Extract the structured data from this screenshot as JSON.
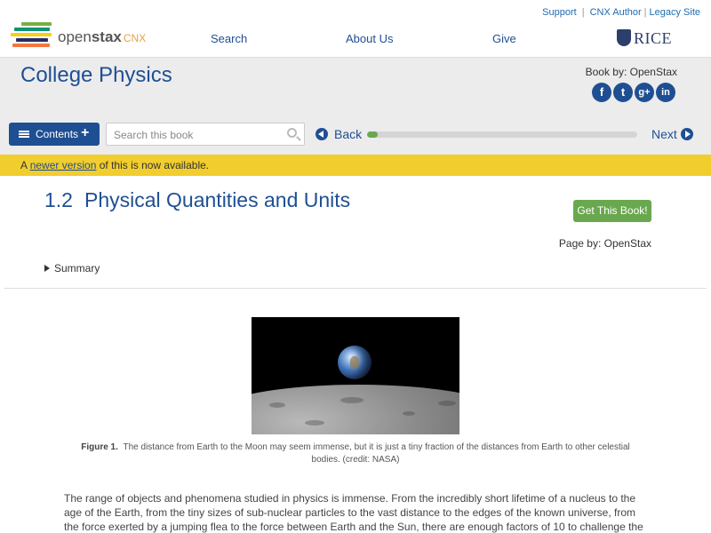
{
  "header": {
    "logo": {
      "brand_light": "open",
      "brand_bold": "stax",
      "suffix": "CNX"
    },
    "utility_links": [
      "Support",
      "CNX Author",
      "Legacy Site"
    ],
    "nav": [
      "Search",
      "About Us",
      "Give"
    ],
    "partner": "RICE"
  },
  "book": {
    "title": "College Physics",
    "book_by": "Book by: OpenStax",
    "social": [
      {
        "icon": "facebook-icon",
        "glyph": "f"
      },
      {
        "icon": "twitter-icon",
        "glyph": "t"
      },
      {
        "icon": "google-plus-icon",
        "glyph": "g+"
      },
      {
        "icon": "linkedin-icon",
        "glyph": "in"
      }
    ]
  },
  "toolbar": {
    "contents_label": "Contents",
    "search_placeholder": "Search this book",
    "back_label": "Back",
    "next_label": "Next",
    "progress": 0.012
  },
  "notice": {
    "prefix": "A ",
    "link": "newer version",
    "suffix": " of this is now available."
  },
  "section": {
    "number": "1.2",
    "title": "Physical Quantities and Units",
    "get_book": "Get This Book!",
    "page_by": "Page by: OpenStax",
    "summary": "Summary"
  },
  "figure": {
    "label": "Figure 1.",
    "caption": "The distance from Earth to the Moon may seem immense, but it is just a tiny fraction of the distances from Earth to other celestial bodies. (credit: NASA)"
  },
  "body": {
    "paragraph": "The range of objects and phenomena studied in physics is immense. From the incredibly short lifetime of a nucleus to the age of the Earth, from the tiny sizes of sub-nuclear particles to the vast distance to the edges of the known universe, from the force exerted by a jumping flea to the force between Earth and the Sun, there are enough factors of 10 to challenge the imagination of even the most"
  },
  "colors": {
    "brand_blue": "#1f4f93",
    "notice_yellow": "#f1cd2e",
    "cta_green": "#6aa84f"
  }
}
